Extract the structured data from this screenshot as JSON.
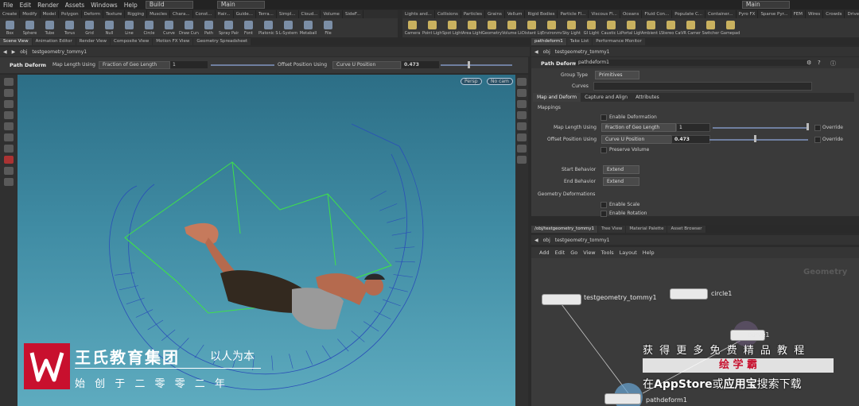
{
  "menu": {
    "items": [
      "File",
      "Edit",
      "Render",
      "Assets",
      "Windows",
      "Help"
    ],
    "desktop": "Build",
    "desktop2": "Main",
    "desktop3": "Main"
  },
  "shelf_tabs_left": [
    "Create",
    "Modify",
    "Model",
    "Polygon",
    "Deform",
    "Texture",
    "Rigging",
    "Muscles",
    "Chara...",
    "Const...",
    "Hair...",
    "Guide...",
    "Terra...",
    "Simpl...",
    "Cloud...",
    "Volume",
    "SideF..."
  ],
  "shelf_tabs_right": [
    "Lights and...",
    "Collisions",
    "Particles",
    "Grains",
    "Vellum",
    "Rigid Bodies",
    "Particle Fl...",
    "Viscous Fl...",
    "Oceans",
    "Fluid Con...",
    "Populate C...",
    "Container...",
    "Pyro FX",
    "Sparse Pyr...",
    "FEM",
    "Wires",
    "Crowds",
    "Drive Sim..."
  ],
  "shelf_tools_left": [
    "Box",
    "Sphere",
    "Tube",
    "Torus",
    "Grid",
    "Null",
    "Line",
    "Circle",
    "Curve",
    "Draw Curve",
    "Path",
    "Spray Paint",
    "Font",
    "Platonic Solids",
    "L-System",
    "Metaball",
    "File"
  ],
  "shelf_tools_right": [
    "Camera",
    "Point Light",
    "Spot Light",
    "Area Light",
    "Geometry Light",
    "Volume Light",
    "Distant Light",
    "Environment Light",
    "Sky Light",
    "GI Light",
    "Caustic Light",
    "Portal Light",
    "Ambient Light",
    "Stereo Camera",
    "VR Camera",
    "Switcher",
    "Gamepad Camera"
  ],
  "viewer": {
    "tabs": [
      "Scene View",
      "Animation Editor",
      "Render View",
      "Composite View",
      "Motion FX View",
      "Geometry Spreadsheet"
    ],
    "path_root": "obj",
    "path_node": "testgeometry_tommy1",
    "op_name": "Path Deform",
    "map_label": "Map Length Using",
    "map_value": "Fraction of Geo Length",
    "map_number": "1",
    "offset_label": "Offset Position Using",
    "offset_value": "Curve U Position",
    "offset_number": "0.473",
    "persp": "Persp",
    "cam": "No cam"
  },
  "params": {
    "tabs": [
      "pathdeform1",
      "Take List",
      "Performance Monitor"
    ],
    "path_root": "obj",
    "path_node": "testgeometry_tommy1",
    "node_type": "Path Deform",
    "node_name": "pathdeform1",
    "group_type_label": "Group Type",
    "group_type_value": "Primitives",
    "curves_label": "Curves",
    "subtabs": [
      "Map and Deform",
      "Capture and Align",
      "Attributes"
    ],
    "mappings_header": "Mappings",
    "enable_deformation": "Enable Deformation",
    "map_label": "Map Length Using",
    "map_value": "Fraction of Geo Length",
    "map_number": "1",
    "override": "Override",
    "offset_label": "Offset Position Using",
    "offset_value": "Curve U Position",
    "offset_number": "0.473",
    "override2": "Override",
    "preserve_volume": "Preserve Volume",
    "start_label": "Start Behavior",
    "start_value": "Extend",
    "end_label": "End Behavior",
    "end_value": "Extend",
    "geo_deform_header": "Geometry Deformations",
    "enable_scale": "Enable Scale",
    "enable_rotation": "Enable Rotation"
  },
  "network": {
    "tabs": [
      "/obj/testgeometry_tommy1",
      "Tree View",
      "Material Palette",
      "Asset Browser"
    ],
    "path_root": "obj",
    "path_node": "testgeometry_tommy1",
    "menu": [
      "Add",
      "Edit",
      "Go",
      "View",
      "Tools",
      "Layout",
      "Help"
    ],
    "context": "Geometry",
    "nodes": [
      {
        "name": "testgeometry_tommy1"
      },
      {
        "name": "circle1"
      },
      {
        "name": "curve1"
      },
      {
        "name": "pathdeform1"
      }
    ]
  },
  "watermark": {
    "brand": "王氏教育集团",
    "slogan": "以人为本",
    "founded": "始 创 于 二 零 零 二 年",
    "promo_line1": "获 得 更 多 免 费 精 品 教 程",
    "promo_brand": "绘 学 霸",
    "promo_line3_a": "在",
    "promo_line3_b": "AppStore",
    "promo_line3_c": "或",
    "promo_line3_d": "应用宝",
    "promo_line3_e": "搜索下载"
  },
  "colors": {
    "viewport_top": "#2c6e86",
    "viewport_bottom": "#5eabbf",
    "guide_green": "#3fe04a",
    "curve_blue": "#2a4fb8",
    "brand_red": "#c8102e"
  }
}
